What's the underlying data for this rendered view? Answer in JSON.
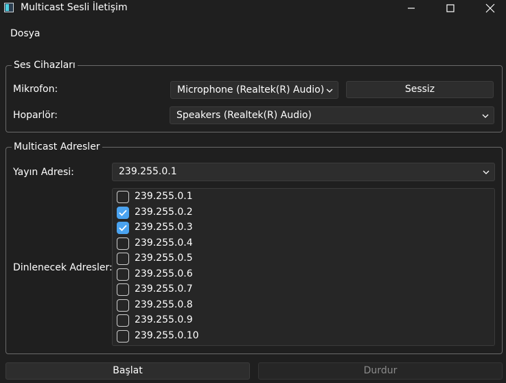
{
  "window": {
    "title": "Multicast Sesli İletişim"
  },
  "menu": {
    "items": [
      "Dosya"
    ]
  },
  "devices": {
    "title": "Ses Cihazları",
    "mic_label": "Mikrofon:",
    "mic_value": "Microphone (Realtek(R) Audio)",
    "mute_label": "Sessiz",
    "speaker_label": "Hoparlör:",
    "speaker_value": "Speakers (Realtek(R) Audio)"
  },
  "multicast": {
    "title": "Multicast Adresler",
    "publish_label": "Yayın Adresi:",
    "publish_value": "239.255.0.1",
    "listen_label": "Dinlenecek Adresler:",
    "addresses": [
      {
        "addr": "239.255.0.1",
        "checked": false
      },
      {
        "addr": "239.255.0.2",
        "checked": true
      },
      {
        "addr": "239.255.0.3",
        "checked": true
      },
      {
        "addr": "239.255.0.4",
        "checked": false
      },
      {
        "addr": "239.255.0.5",
        "checked": false
      },
      {
        "addr": "239.255.0.6",
        "checked": false
      },
      {
        "addr": "239.255.0.7",
        "checked": false
      },
      {
        "addr": "239.255.0.8",
        "checked": false
      },
      {
        "addr": "239.255.0.9",
        "checked": false
      },
      {
        "addr": "239.255.0.10",
        "checked": false
      }
    ]
  },
  "actions": {
    "start_label": "Başlat",
    "stop_label": "Durdur"
  },
  "colors": {
    "accent": "#4aa3f0",
    "background": "#1f1f1f",
    "control": "#2d2d2d"
  }
}
